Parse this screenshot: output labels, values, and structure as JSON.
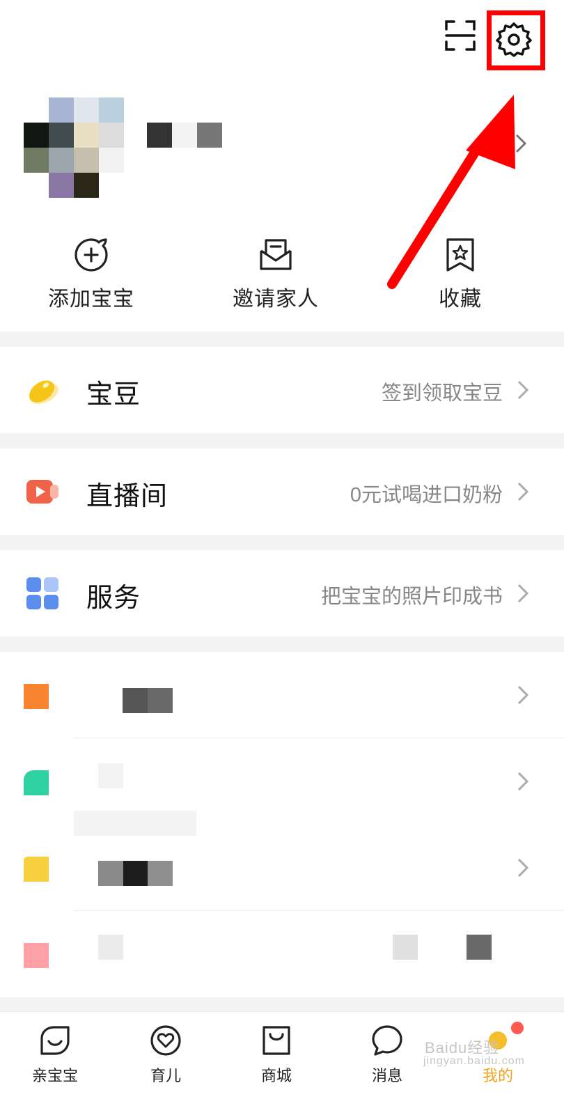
{
  "header": {
    "scan_icon": "scan-icon",
    "settings_icon": "gear-icon",
    "highlight_color": "#ff0000"
  },
  "quick_actions": [
    {
      "label": "添加宝宝",
      "icon": "add-baby-icon"
    },
    {
      "label": "邀请家人",
      "icon": "invite-mail-icon"
    },
    {
      "label": "收藏",
      "icon": "bookmark-star-icon"
    }
  ],
  "menu": [
    {
      "title": "宝豆",
      "hint": "签到领取宝豆",
      "icon": "bean-icon"
    },
    {
      "title": "直播间",
      "hint": "0元试喝进口奶粉",
      "icon": "live-icon"
    },
    {
      "title": "服务",
      "hint": "把宝宝的照片印成书",
      "icon": "grid-icon"
    }
  ],
  "bottom_nav": [
    {
      "label": "亲宝宝",
      "icon": "leaf-face-icon"
    },
    {
      "label": "育儿",
      "icon": "heart-circle-icon"
    },
    {
      "label": "商城",
      "icon": "shopping-bag-icon"
    },
    {
      "label": "消息",
      "icon": "chat-bubble-icon"
    },
    {
      "label": "我的",
      "icon": "profile-tab-icon",
      "active": true
    }
  ],
  "watermark": {
    "text": "Baidu经验",
    "url": "jingyan.baidu.com"
  },
  "colors": {
    "accent": "#f3a01a",
    "arrow": "#ff0000",
    "badge": "#ff5a4f"
  }
}
